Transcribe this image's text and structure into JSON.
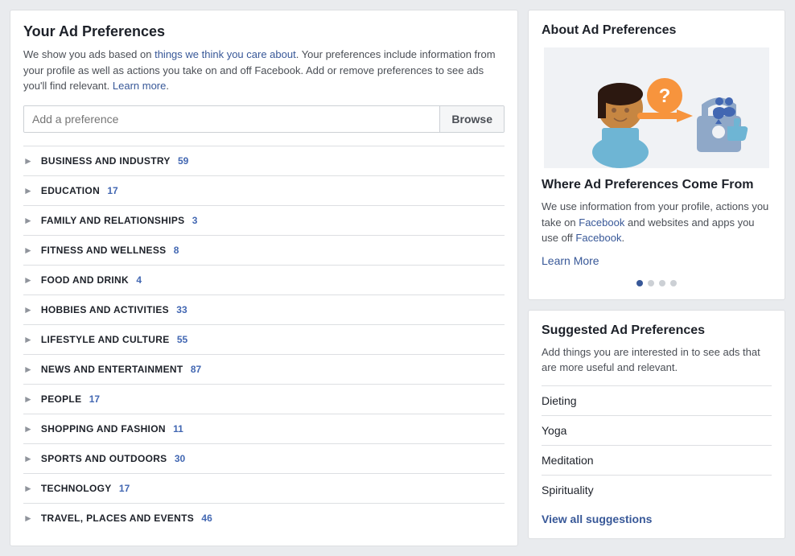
{
  "left": {
    "title": "Your Ad Preferences",
    "description_parts": [
      "We show you ads based on things we think you care about. Your preferences include information from your profile as well as actions you take on and off Facebook. Add or remove preferences to see ads you'll find relevant. ",
      "Learn more",
      "."
    ],
    "search_placeholder": "Add a preference",
    "browse_label": "Browse",
    "categories": [
      {
        "name": "BUSINESS AND INDUSTRY",
        "count": "59"
      },
      {
        "name": "EDUCATION",
        "count": "17"
      },
      {
        "name": "FAMILY AND RELATIONSHIPS",
        "count": "3"
      },
      {
        "name": "FITNESS AND WELLNESS",
        "count": "8"
      },
      {
        "name": "FOOD AND DRINK",
        "count": "4"
      },
      {
        "name": "HOBBIES AND ACTIVITIES",
        "count": "33"
      },
      {
        "name": "LIFESTYLE AND CULTURE",
        "count": "55"
      },
      {
        "name": "NEWS AND ENTERTAINMENT",
        "count": "87"
      },
      {
        "name": "PEOPLE",
        "count": "17"
      },
      {
        "name": "SHOPPING AND FASHION",
        "count": "11"
      },
      {
        "name": "SPORTS AND OUTDOORS",
        "count": "30"
      },
      {
        "name": "TECHNOLOGY",
        "count": "17"
      },
      {
        "name": "TRAVEL, PLACES AND EVENTS",
        "count": "46"
      }
    ]
  },
  "right": {
    "about_title": "About Ad Preferences",
    "where_title": "Where Ad Preferences Come From",
    "where_desc_1": "We use information from your profile, actions you take on ",
    "where_desc_facebook": "Facebook",
    "where_desc_2": " and websites and apps you use off ",
    "where_desc_facebook2": "Facebook",
    "where_desc_end": ".",
    "learn_more_label": "Learn More",
    "carousel_dots": [
      {
        "active": true
      },
      {
        "active": false
      },
      {
        "active": false
      },
      {
        "active": false
      }
    ],
    "suggested_title": "Suggested Ad Preferences",
    "suggested_desc": "Add things you are interested in to see ads that are more useful and relevant.",
    "suggestions": [
      "Dieting",
      "Yoga",
      "Meditation",
      "Spirituality"
    ],
    "view_all_label": "View all suggestions"
  }
}
